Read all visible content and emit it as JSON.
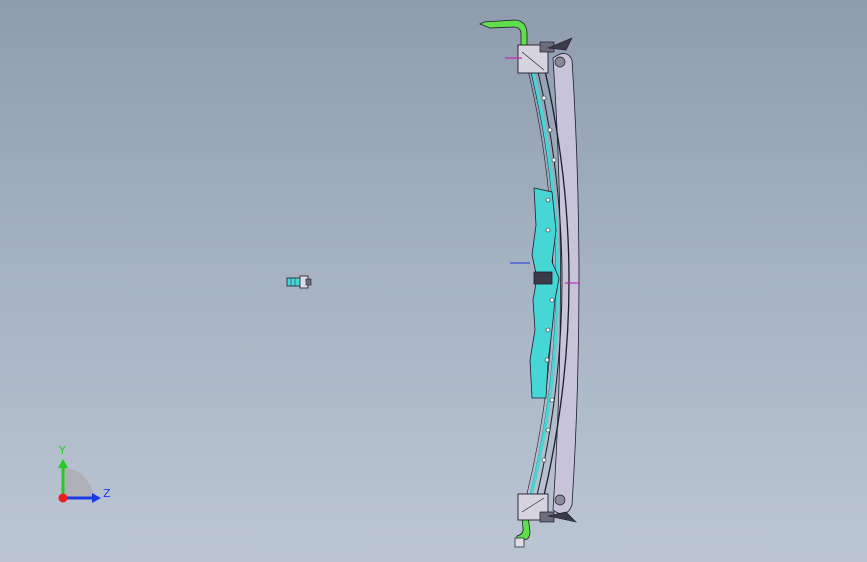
{
  "viewport": {
    "background_top": "#8e9cae",
    "background_bottom": "#bcc6d3"
  },
  "triad": {
    "y_label": "Y",
    "z_label": "Z",
    "x_color": "#e8201e",
    "y_color": "#22cc22",
    "z_color": "#1a3ce6"
  },
  "model": {
    "tube_color": "#5fe04a",
    "panel_color": "#47d6d6",
    "frame_color": "#c7c3d8",
    "outline_color": "#1c1c2a",
    "marker_color": "#c028c0",
    "axis_mark_color": "#2233dd"
  },
  "components": {
    "main_assembly_icon": "wiper-assembly-icon",
    "small_part_icon": "bolt-part-icon",
    "triad_icon": "coordinate-triad-icon"
  }
}
